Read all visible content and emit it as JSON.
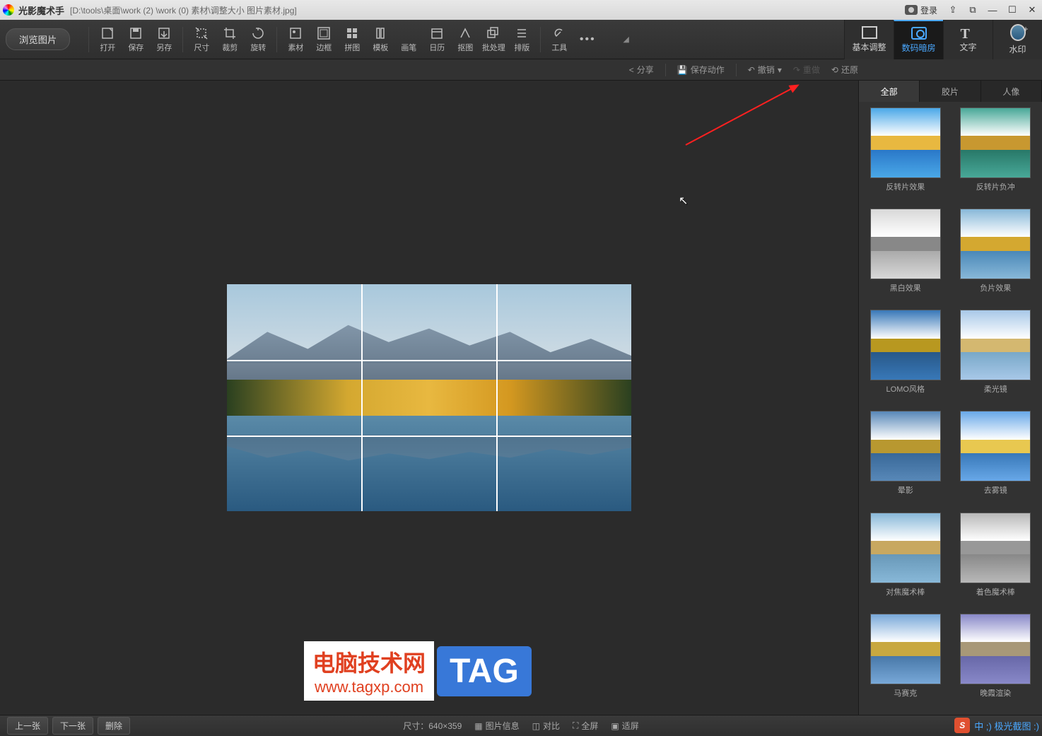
{
  "title_bar": {
    "app_name": "光影魔术手",
    "file_path": "[D:\\tools\\桌面\\work (2) \\work (0) 素材\\调整大小 图片素材.jpg]",
    "login": "登录"
  },
  "toolbar": {
    "browse": "浏览图片",
    "items": [
      {
        "label": "打开",
        "icon": "open"
      },
      {
        "label": "保存",
        "icon": "save"
      },
      {
        "label": "另存",
        "icon": "saveas"
      },
      {
        "label": "尺寸",
        "icon": "resize"
      },
      {
        "label": "裁剪",
        "icon": "crop"
      },
      {
        "label": "旋转",
        "icon": "rotate"
      },
      {
        "label": "素材",
        "icon": "material"
      },
      {
        "label": "边框",
        "icon": "border"
      },
      {
        "label": "拼图",
        "icon": "collage"
      },
      {
        "label": "模板",
        "icon": "template"
      },
      {
        "label": "画笔",
        "icon": "brush"
      },
      {
        "label": "日历",
        "icon": "calendar"
      },
      {
        "label": "抠图",
        "icon": "cutout"
      },
      {
        "label": "批处理",
        "icon": "batch"
      },
      {
        "label": "排版",
        "icon": "layout"
      },
      {
        "label": "工具",
        "icon": "tools"
      }
    ]
  },
  "right_tabs": {
    "basic": "基本调整",
    "darkroom": "数码暗房",
    "text": "文字",
    "watermark": "水印"
  },
  "secondary": {
    "share": "分享",
    "save_action": "保存动作",
    "undo": "撤销",
    "redo": "重做",
    "restore": "还原"
  },
  "filter_panel": {
    "tabs": {
      "all": "全部",
      "film": "胶片",
      "portrait": "人像"
    },
    "filters": [
      {
        "label": "反转片效果",
        "style": "vivid"
      },
      {
        "label": "反转片负冲",
        "style": "cross"
      },
      {
        "label": "黑白效果",
        "style": "bw"
      },
      {
        "label": "负片效果",
        "style": "neg"
      },
      {
        "label": "LOMO风格",
        "style": "lomo"
      },
      {
        "label": "柔光镜",
        "style": "soft"
      },
      {
        "label": "晕影",
        "style": "vignette"
      },
      {
        "label": "去雾镜",
        "style": "dehaze"
      },
      {
        "label": "对焦魔术棒",
        "style": "focus"
      },
      {
        "label": "着色魔术棒",
        "style": "colorize"
      },
      {
        "label": "马赛克",
        "style": "mosaic"
      },
      {
        "label": "晚霞渲染",
        "style": "sunset"
      }
    ]
  },
  "status_bar": {
    "prev": "上一张",
    "next": "下一张",
    "delete": "删除",
    "dimensions": "尺寸：640×359",
    "info": "图片信息",
    "compare": "对比",
    "fullscreen": "全屏",
    "fitscreen": "适屏"
  },
  "watermark": {
    "red_top": "电脑技术网",
    "red_bot": "www.tagxp.com",
    "blue": "TAG"
  },
  "ime": {
    "label": "中 ;) 极光截图 :)"
  },
  "colors": {
    "accent": "#4aa8ff",
    "arrow": "#ff2020"
  }
}
